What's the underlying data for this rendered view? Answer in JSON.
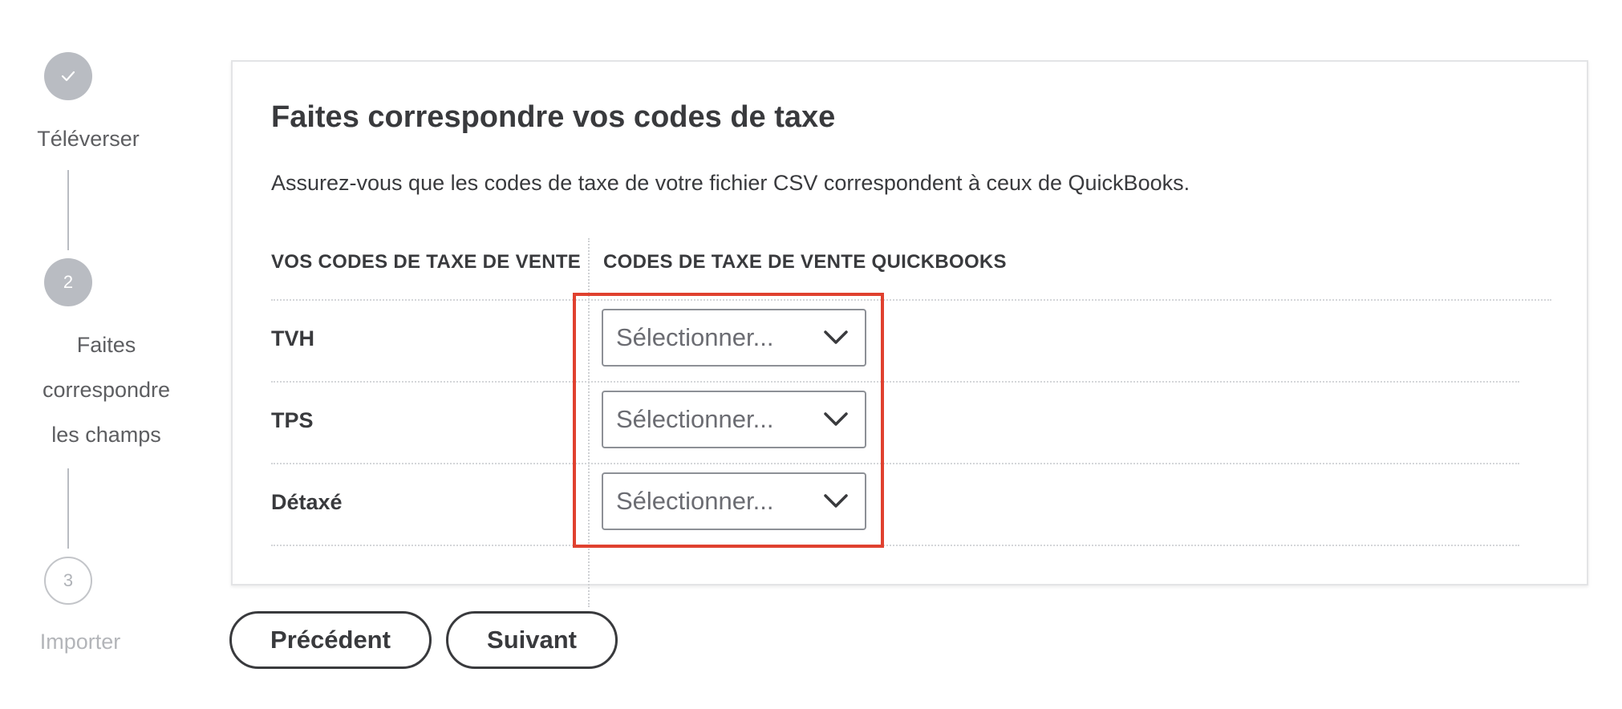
{
  "stepper": {
    "steps": [
      {
        "marker": "",
        "label": "Téléverser",
        "state": "completed",
        "icon": "check-icon"
      },
      {
        "marker": "2",
        "label_lines": [
          "Faites",
          "correspondre",
          "les champs"
        ],
        "state": "active"
      },
      {
        "marker": "3",
        "label": "Importer",
        "state": "upcoming"
      }
    ]
  },
  "card": {
    "title": "Faites correspondre vos codes de taxe",
    "description": "Assurez-vous que les codes de taxe de votre fichier CSV correspondent à ceux de QuickBooks.",
    "columns": {
      "left": "VOS CODES DE TAXE DE VENTE",
      "right": "CODES DE TAXE DE VENTE QUICKBOOKS"
    },
    "rows": [
      {
        "label": "TVH",
        "select_value": "Sélectionner..."
      },
      {
        "label": "TPS",
        "select_value": "Sélectionner..."
      },
      {
        "label": "Détaxé",
        "select_value": "Sélectionner..."
      }
    ]
  },
  "footer": {
    "previous_label": "Précédent",
    "next_label": "Suivant"
  },
  "colors": {
    "text": "#393a3d",
    "step_fill": "#b9bcc2",
    "highlight": "#e0412f",
    "select_border": "#8d9096"
  }
}
